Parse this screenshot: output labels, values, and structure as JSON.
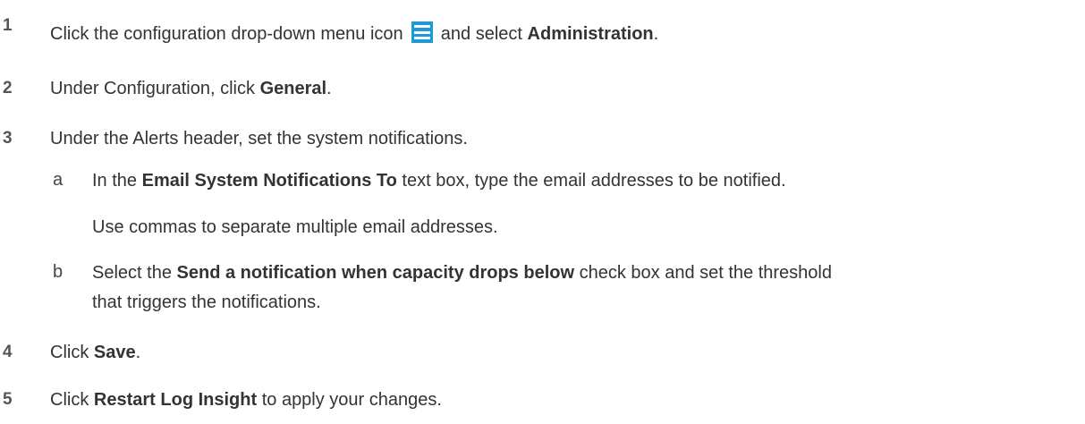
{
  "steps": [
    {
      "number": "1",
      "prefix": "Click the configuration drop-down menu icon",
      "middle": "and select",
      "bold": "Administration",
      "suffix": "."
    },
    {
      "number": "2",
      "prefix": "Under Configuration, click",
      "bold": "General",
      "suffix": "."
    },
    {
      "number": "3",
      "text": "Under the Alerts header, set the system notifications."
    },
    {
      "number": "4",
      "prefix": "Click",
      "bold": "Save",
      "suffix": "."
    },
    {
      "number": "5",
      "prefix": "Click",
      "bold": "Restart Log Insight",
      "suffix": "to apply your changes."
    }
  ],
  "substeps": [
    {
      "letter": "a",
      "prefix": "In the",
      "bold": "Email System Notifications To",
      "suffix": "text box, type the email addresses to be notified.",
      "note": "Use commas to separate multiple email addresses."
    },
    {
      "letter": "b",
      "prefix": "Select the",
      "bold": "Send a notification when capacity drops below",
      "suffix_line1": "check box and set the threshold",
      "line2": "that triggers the notifications."
    }
  ],
  "icons": {
    "menu_icon": "hamburger-menu-icon",
    "menu_icon_color": "#1e9ad6"
  }
}
